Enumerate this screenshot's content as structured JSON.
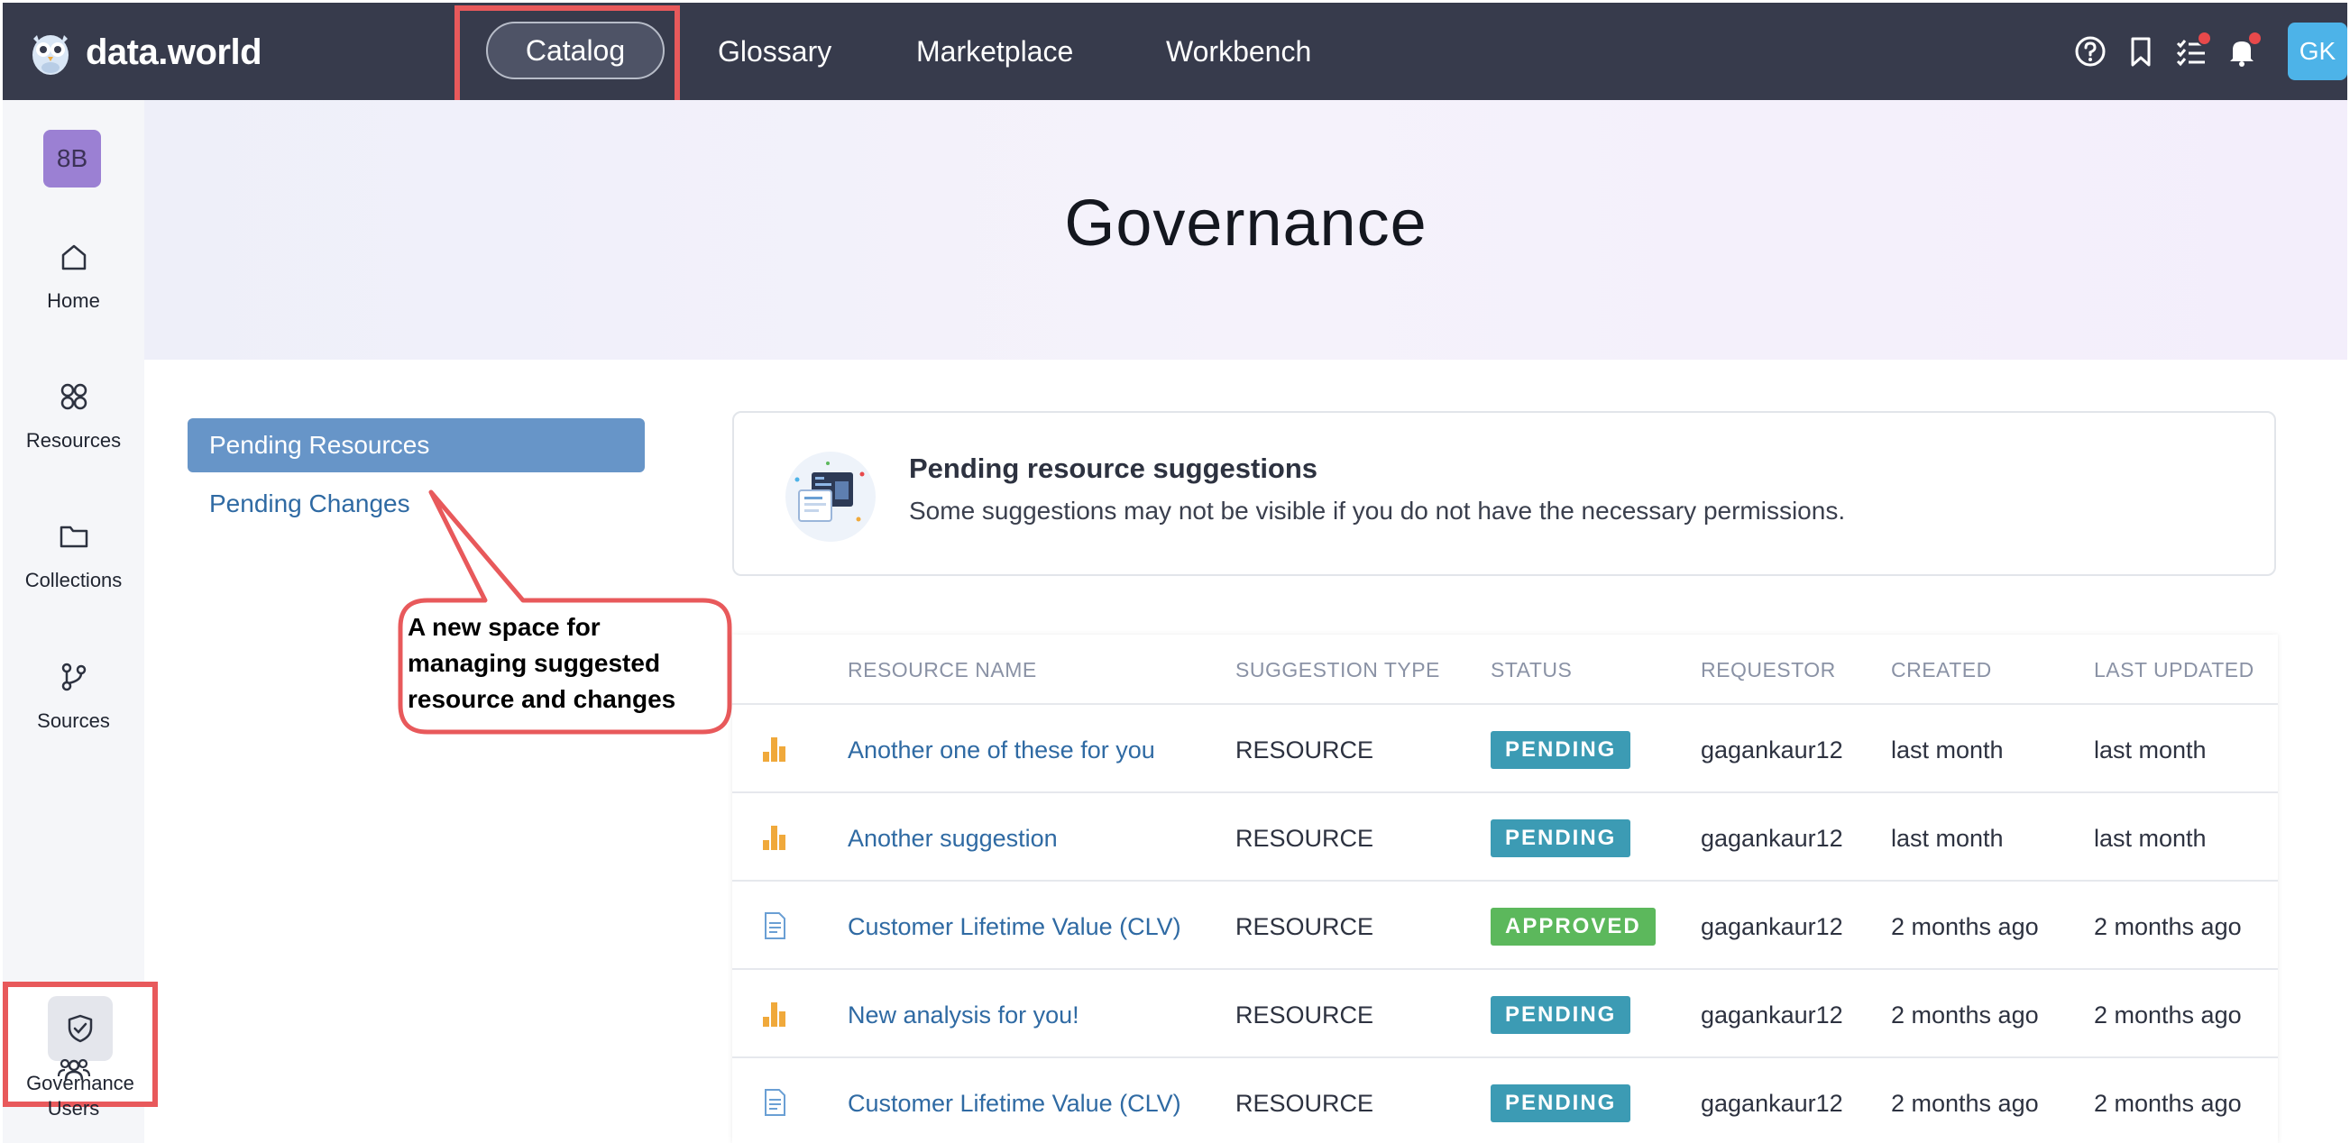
{
  "brand": {
    "name": "data.world"
  },
  "topnav": {
    "items": [
      {
        "label": "Catalog",
        "active": true
      },
      {
        "label": "Glossary"
      },
      {
        "label": "Marketplace"
      },
      {
        "label": "Workbench"
      }
    ],
    "icons": [
      "help-icon",
      "bookmark-icon",
      "tasks-icon",
      "bell-icon"
    ],
    "user_initials": "GK"
  },
  "sidebar": {
    "space_badge": "8B",
    "items": [
      {
        "label": "Home",
        "icon": "home-icon"
      },
      {
        "label": "Resources",
        "icon": "resources-icon"
      },
      {
        "label": "Collections",
        "icon": "folder-icon"
      },
      {
        "label": "Sources",
        "icon": "sources-icon"
      },
      {
        "label": "Governance",
        "icon": "shield-icon",
        "active": true
      },
      {
        "label": "Users",
        "icon": "users-icon"
      }
    ]
  },
  "hero": {
    "title": "Governance"
  },
  "subnav": {
    "active": "Pending Resources",
    "link": "Pending Changes"
  },
  "callout": {
    "lines": [
      "A new space for",
      "managing suggested",
      "resource and changes"
    ]
  },
  "info": {
    "title": "Pending resource suggestions",
    "subtitle": "Some suggestions may not be visible if you do not have the necessary permissions."
  },
  "table": {
    "headers": [
      "RESOURCE NAME",
      "SUGGESTION TYPE",
      "STATUS",
      "REQUESTOR",
      "CREATED",
      "LAST UPDATED"
    ],
    "rows": [
      {
        "icon": "analysis-icon",
        "name": "Another one of these for you",
        "type": "RESOURCE",
        "status": "PENDING",
        "requestor": "gagankaur12",
        "created": "last month",
        "updated": "last month"
      },
      {
        "icon": "analysis-icon",
        "name": "Another suggestion",
        "type": "RESOURCE",
        "status": "PENDING",
        "requestor": "gagankaur12",
        "created": "last month",
        "updated": "last month"
      },
      {
        "icon": "document-icon",
        "name": "Customer Lifetime Value (CLV)",
        "type": "RESOURCE",
        "status": "APPROVED",
        "requestor": "gagankaur12",
        "created": "2 months ago",
        "updated": "2 months ago"
      },
      {
        "icon": "analysis-icon",
        "name": "New analysis for you!",
        "type": "RESOURCE",
        "status": "PENDING",
        "requestor": "gagankaur12",
        "created": "2 months ago",
        "updated": "2 months ago"
      },
      {
        "icon": "document-icon",
        "name": "Customer Lifetime Value (CLV)",
        "type": "RESOURCE",
        "status": "PENDING",
        "requestor": "gagankaur12",
        "created": "2 months ago",
        "updated": "2 months ago"
      }
    ]
  },
  "colors": {
    "topbar": "#373b4c",
    "accent_blue": "#6795c8",
    "link": "#2f6aa3",
    "pending": "#3c9bb4",
    "approved": "#5cb85c",
    "highlight": "#e8595b",
    "analysis_icon": "#f0a93b",
    "document_icon": "#6a9fd4"
  }
}
